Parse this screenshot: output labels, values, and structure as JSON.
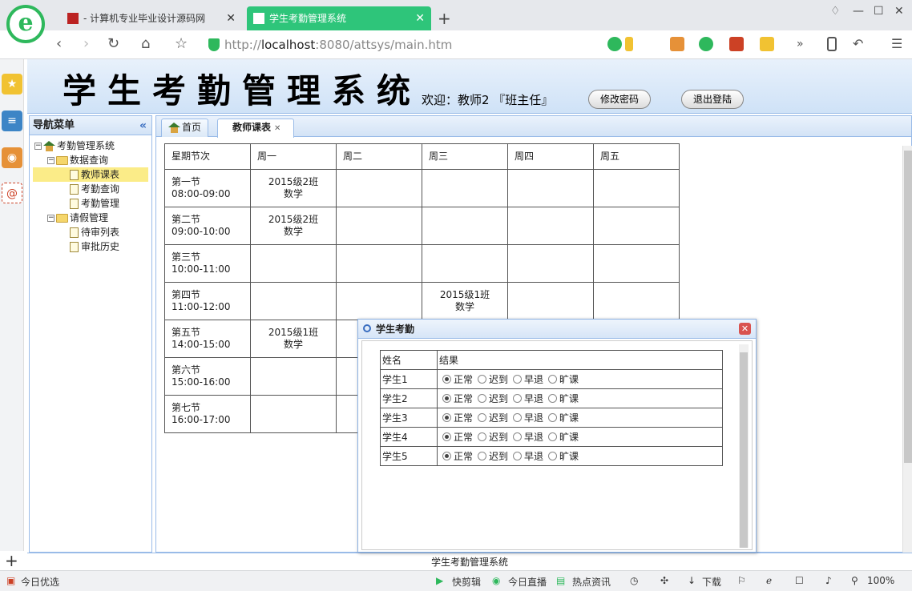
{
  "browser": {
    "tabs": [
      {
        "label": "- 计算机专业毕业设计源码网"
      },
      {
        "label": "学生考勤管理系统"
      }
    ],
    "url_prefix": "http://",
    "url_host": "localhost",
    "url_rest": ":8080/attsys/main.htm",
    "status": {
      "left": "今日优选",
      "quick_edit": "快剪辑",
      "live": "今日直播",
      "hot": "热点资讯",
      "download": "下载",
      "zoom": "100%"
    }
  },
  "app": {
    "title": "学生考勤管理系统",
    "welcome": "欢迎：教师2 『班主任』",
    "change_password": "修改密码",
    "logout": "退出登陆",
    "footer": "学生考勤管理系统"
  },
  "nav": {
    "header": "导航菜单",
    "root": "考勤管理系统",
    "groups": [
      {
        "label": "数据查询",
        "items": [
          "教师课表",
          "考勤查询",
          "考勤管理"
        ]
      },
      {
        "label": "请假管理",
        "items": [
          "待审列表",
          "审批历史"
        ]
      }
    ]
  },
  "tabs": {
    "home": "首页",
    "active": "教师课表"
  },
  "schedule": {
    "headers": [
      "星期节次",
      "周一",
      "周二",
      "周三",
      "周四",
      "周五"
    ],
    "rows": [
      {
        "period": "第一节",
        "time": "08:00-09:00",
        "cells": [
          "2015级2班\n数学",
          "",
          "",
          "",
          ""
        ]
      },
      {
        "period": "第二节",
        "time": "09:00-10:00",
        "cells": [
          "2015级2班\n数学",
          "",
          "",
          "",
          ""
        ]
      },
      {
        "period": "第三节",
        "time": "10:00-11:00",
        "cells": [
          "",
          "",
          "",
          "",
          ""
        ]
      },
      {
        "period": "第四节",
        "time": "11:00-12:00",
        "cells": [
          "",
          "",
          "2015级1班\n数学",
          "",
          ""
        ]
      },
      {
        "period": "第五节",
        "time": "14:00-15:00",
        "cells": [
          "2015级1班\n数学",
          "",
          "",
          "",
          ""
        ]
      },
      {
        "period": "第六节",
        "time": "15:00-16:00",
        "cells": [
          "",
          "",
          "",
          "",
          ""
        ]
      },
      {
        "period": "第七节",
        "time": "16:00-17:00",
        "cells": [
          "",
          "",
          "",
          "",
          ""
        ]
      }
    ]
  },
  "dialog": {
    "title": "学生考勤",
    "col_name": "姓名",
    "col_result": "结果",
    "options": [
      "正常",
      "迟到",
      "早退",
      "旷课"
    ],
    "students": [
      {
        "name": "学生1",
        "selected": "正常"
      },
      {
        "name": "学生2",
        "selected": "正常"
      },
      {
        "name": "学生3",
        "selected": "正常"
      },
      {
        "name": "学生4",
        "selected": "正常"
      },
      {
        "name": "学生5",
        "selected": "正常"
      }
    ]
  }
}
